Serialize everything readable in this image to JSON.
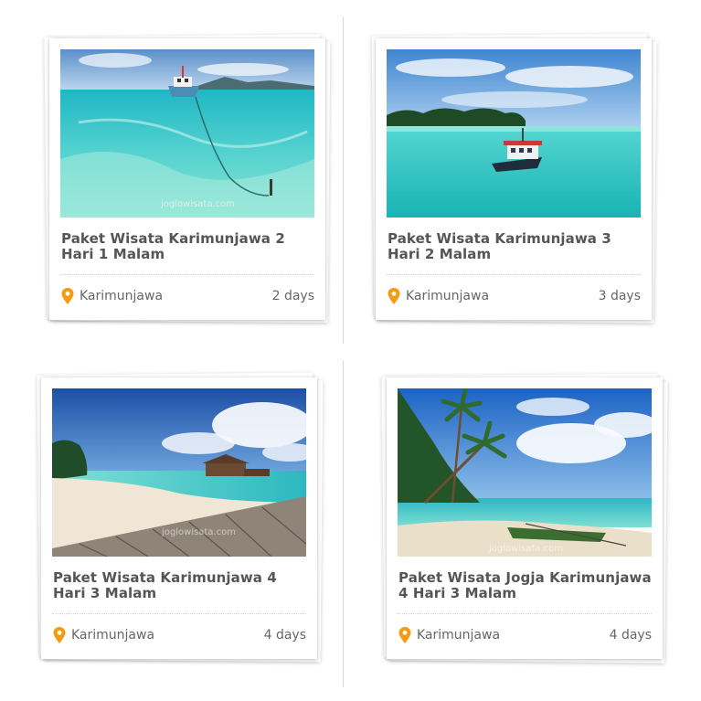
{
  "tours": [
    {
      "title": "Paket Wisata Karimunjawa 2 Hari 1 Malam",
      "location": "Karimunjawa",
      "duration": "2 days",
      "watermark": "joglowisata.com"
    },
    {
      "title": "Paket Wisata Karimunjawa 3 Hari 2 Malam",
      "location": "Karimunjawa",
      "duration": "3 days",
      "watermark": ""
    },
    {
      "title": "Paket Wisata Karimunjawa 4 Hari 3 Malam",
      "location": "Karimunjawa",
      "duration": "4 days",
      "watermark": "joglowisata.com"
    },
    {
      "title": "Paket Wisata Jogja Karimunjawa 4 Hari 3 Malam",
      "location": "Karimunjawa",
      "duration": "4 days",
      "watermark": "joglowisata.com"
    }
  ],
  "colors": {
    "pin": "#f39c12",
    "title": "#555555",
    "meta": "#666666"
  },
  "icons": {
    "location": "map-pin-icon"
  }
}
